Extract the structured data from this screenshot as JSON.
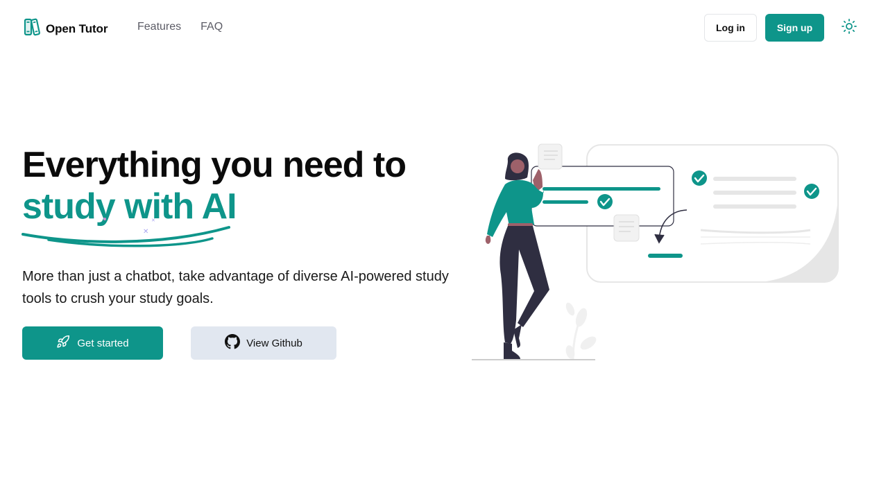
{
  "brand": {
    "name": "Open Tutor",
    "logo_icon": "books-icon"
  },
  "nav": {
    "items": [
      {
        "label": "Features"
      },
      {
        "label": "FAQ"
      }
    ]
  },
  "auth": {
    "login_label": "Log in",
    "signup_label": "Sign up"
  },
  "theme_toggle": {
    "icon": "sun-icon"
  },
  "hero": {
    "title_line1": "Everything you need to",
    "title_line2": "study with AI",
    "subtitle": "More than just a chatbot, take advantage of diverse AI-powered study tools to crush your study goals.",
    "primary_cta": {
      "label": "Get started",
      "icon": "rocket-icon"
    },
    "secondary_cta": {
      "label": "View Github",
      "icon": "github-icon"
    }
  },
  "colors": {
    "brand": "#0e958a",
    "heading": "#0b0b0b",
    "secondary_button_bg": "#e1e7f0",
    "nav_text": "#5c5c66"
  }
}
